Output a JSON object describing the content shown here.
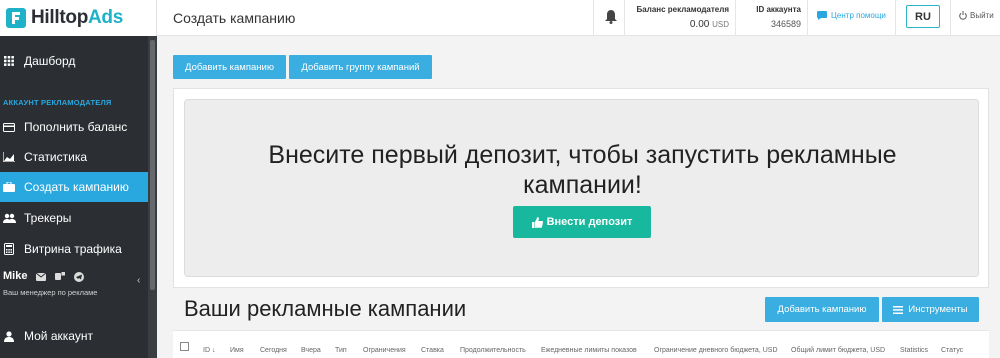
{
  "brand": {
    "name_main": "Hilltop",
    "name_accent": "Ads",
    "color": "#1fb1c7"
  },
  "sidebar": {
    "dashboard": "Дашборд",
    "section": "АККАУНТ РЕКЛАМОДАТЕЛЯ",
    "items": [
      {
        "label": "Пополнить баланс",
        "icon": "credit-card-icon"
      },
      {
        "label": "Статистика",
        "icon": "chart-icon"
      },
      {
        "label": "Создать кампанию",
        "icon": "briefcase-icon",
        "active": true
      },
      {
        "label": "Трекеры",
        "icon": "users-icon"
      },
      {
        "label": "Витрина трафика",
        "icon": "calculator-icon"
      }
    ],
    "manager_name": "Mike",
    "manager_sub": "Ваш менеджер по рекламе",
    "account": "Мой аккаунт"
  },
  "header": {
    "title": "Создать кампанию",
    "balance_label": "Баланс рекламодателя",
    "balance_value": "0.00",
    "balance_currency": "USD",
    "account_label": "ID аккаунта",
    "account_id": "346589",
    "help": "Центр помощи",
    "lang": "RU",
    "logout": "Выйти"
  },
  "actions": {
    "add_campaign": "Добавить кампанию",
    "add_group": "Добавить группу кампаний"
  },
  "promo": {
    "headline_line1": "Внесите первый депозит, чтобы запустить рекламные",
    "headline_line2": "кампании!",
    "deposit_button": "Внести депозит"
  },
  "campaigns": {
    "title": "Ваши рекламные кампании",
    "add_button": "Добавить кампанию",
    "tools_button": "Инструменты",
    "columns": [
      "ID",
      "Имя",
      "Сегодня",
      "Вчера",
      "Тип",
      "Ограничения",
      "Ставка",
      "Продолжительность",
      "Ежедневные лимиты показов",
      "Ограничение дневного бюджета, USD",
      "Общий лимит бюджета, USD",
      "Statistics",
      "Статус"
    ]
  },
  "colors": {
    "accent": "#29a8e0",
    "deposit": "#17b89e",
    "sidebar": "#2b2e33"
  }
}
